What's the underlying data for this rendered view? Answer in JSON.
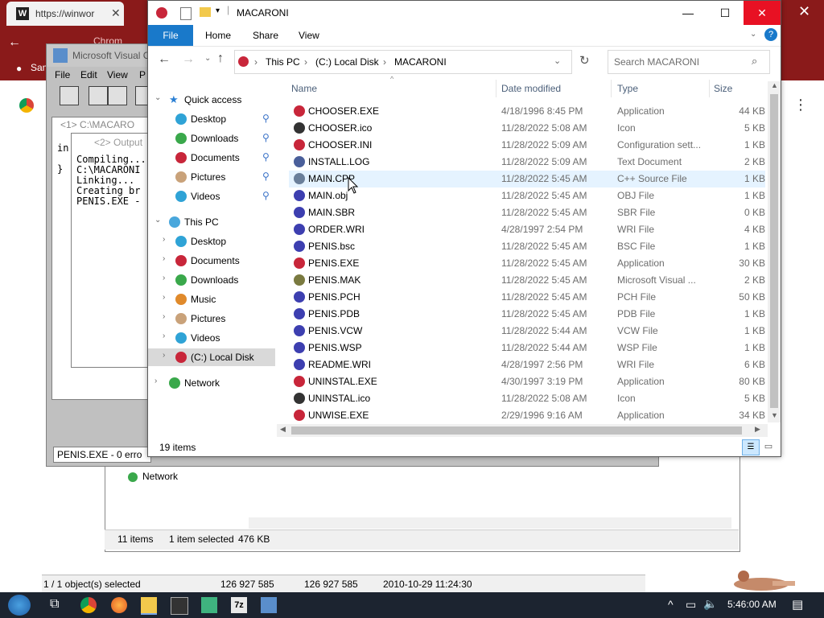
{
  "chrome": {
    "tab_title": "https://winwor",
    "tab2_title": "Chrom",
    "profile_label": "Sam"
  },
  "msvc": {
    "title": "Microsoft Visual C",
    "menu": [
      "File",
      "Edit",
      "View",
      "P"
    ],
    "doc_title": "<1> C:\\MACARO",
    "doc_lines": [
      "in",
      "}"
    ],
    "output_title": "<2> Output",
    "output_lines": [
      "Compiling...",
      "C:\\MACARONI",
      "Linking...",
      "Creating br",
      "PENIS.EXE -"
    ],
    "status": "PENIS.EXE - 0 erro"
  },
  "old_explorer": {
    "network_label": "Network",
    "items_count": "11 items",
    "selection": "1 item selected",
    "size": "476 KB"
  },
  "bottom_status": {
    "selected": "1 / 1 object(s) selected",
    "size1": "126 927 585",
    "size2": "126 927 585",
    "date": "2010-10-29 11:24:30"
  },
  "explorer": {
    "title": "MACARONI",
    "ribbon": {
      "file": "File",
      "tabs": [
        "Home",
        "Share",
        "View"
      ]
    },
    "address": {
      "this_pc": "This PC",
      "drive": "(C:) Local Disk",
      "folder": "MACARONI"
    },
    "search_placeholder": "Search MACARONI",
    "nav": {
      "quick_access": "Quick access",
      "qa_items": [
        "Desktop",
        "Downloads",
        "Documents",
        "Pictures",
        "Videos"
      ],
      "this_pc": "This PC",
      "pc_items": [
        "Desktop",
        "Documents",
        "Downloads",
        "Music",
        "Pictures",
        "Videos",
        "(C:) Local Disk"
      ],
      "network": "Network"
    },
    "columns": [
      "Name",
      "Date modified",
      "Type",
      "Size"
    ],
    "files": [
      {
        "name": "CHOOSER.EXE",
        "date": "4/18/1996 8:45 PM",
        "type": "Application",
        "size": "44 KB",
        "icon": "exe-icon"
      },
      {
        "name": "CHOOSER.ico",
        "date": "11/28/2022 5:08 AM",
        "type": "Icon",
        "size": "5 KB",
        "icon": "ico-icon"
      },
      {
        "name": "CHOOSER.INI",
        "date": "11/28/2022 5:09 AM",
        "type": "Configuration sett...",
        "size": "1 KB",
        "icon": "ini-icon"
      },
      {
        "name": "INSTALL.LOG",
        "date": "11/28/2022 5:09 AM",
        "type": "Text Document",
        "size": "2 KB",
        "icon": "log-icon"
      },
      {
        "name": "MAIN.CPP",
        "date": "11/28/2022 5:45 AM",
        "type": "C++ Source File",
        "size": "1 KB",
        "icon": "cpp-icon"
      },
      {
        "name": "MAIN.obj",
        "date": "11/28/2022 5:45 AM",
        "type": "OBJ File",
        "size": "1 KB",
        "icon": "obj-icon"
      },
      {
        "name": "MAIN.SBR",
        "date": "11/28/2022 5:45 AM",
        "type": "SBR File",
        "size": "0 KB",
        "icon": "sbr-icon"
      },
      {
        "name": "ORDER.WRI",
        "date": "4/28/1997 2:54 PM",
        "type": "WRI File",
        "size": "4 KB",
        "icon": "wri-icon"
      },
      {
        "name": "PENIS.bsc",
        "date": "11/28/2022 5:45 AM",
        "type": "BSC File",
        "size": "1 KB",
        "icon": "bsc-icon"
      },
      {
        "name": "PENIS.EXE",
        "date": "11/28/2022 5:45 AM",
        "type": "Application",
        "size": "30 KB",
        "icon": "exe-icon"
      },
      {
        "name": "PENIS.MAK",
        "date": "11/28/2022 5:45 AM",
        "type": "Microsoft Visual ...",
        "size": "2 KB",
        "icon": "mak-icon"
      },
      {
        "name": "PENIS.PCH",
        "date": "11/28/2022 5:45 AM",
        "type": "PCH File",
        "size": "50 KB",
        "icon": "pch-icon"
      },
      {
        "name": "PENIS.PDB",
        "date": "11/28/2022 5:45 AM",
        "type": "PDB File",
        "size": "1 KB",
        "icon": "pdb-icon"
      },
      {
        "name": "PENIS.VCW",
        "date": "11/28/2022 5:44 AM",
        "type": "VCW File",
        "size": "1 KB",
        "icon": "vcw-icon"
      },
      {
        "name": "PENIS.WSP",
        "date": "11/28/2022 5:44 AM",
        "type": "WSP File",
        "size": "1 KB",
        "icon": "wsp-icon"
      },
      {
        "name": "README.WRI",
        "date": "4/28/1997 2:56 PM",
        "type": "WRI File",
        "size": "6 KB",
        "icon": "wri-icon"
      },
      {
        "name": "UNINSTAL.EXE",
        "date": "4/30/1997 3:19 PM",
        "type": "Application",
        "size": "80 KB",
        "icon": "exe-icon"
      },
      {
        "name": "UNINSTAL.ico",
        "date": "11/28/2022 5:08 AM",
        "type": "Icon",
        "size": "5 KB",
        "icon": "ico-icon"
      },
      {
        "name": "UNWISE.EXE",
        "date": "2/29/1996 9:16 AM",
        "type": "Application",
        "size": "34 KB",
        "icon": "exe-icon"
      }
    ],
    "status": "19 items"
  },
  "taskbar": {
    "time": "5:46:00 AM"
  },
  "colors": {
    "accent": "#1979ca",
    "hover_row": "#e5f3ff",
    "selected_nav": "#cce8ff"
  }
}
